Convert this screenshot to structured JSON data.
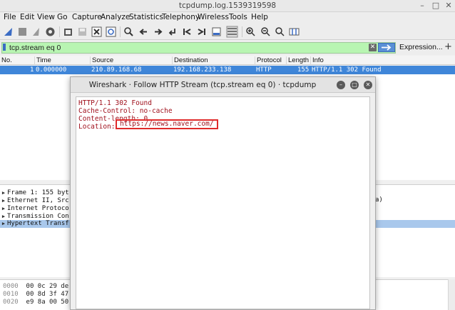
{
  "window": {
    "title": "tcpdump.log.1539319598",
    "controls": [
      "–",
      "□",
      "✕"
    ]
  },
  "menu": [
    "File",
    "Edit",
    "View",
    "Go",
    "Capture",
    "Analyze",
    "Statistics",
    "Telephony",
    "Wireless",
    "Tools",
    "Help"
  ],
  "toolbar": {
    "icons": [
      "shark-fin-start-icon",
      "stop-capture-icon",
      "restart-capture-icon",
      "capture-options-icon",
      "open-file-icon",
      "save-file-icon",
      "close-file-icon",
      "reload-file-icon",
      "find-packet-icon",
      "go-back-icon",
      "go-forward-icon",
      "go-to-packet-icon",
      "first-packet-icon",
      "last-packet-icon",
      "auto-scroll-icon",
      "colorize-icon",
      "zoom-in-icon",
      "zoom-out-icon",
      "normal-size-icon",
      "resize-columns-icon"
    ]
  },
  "filter": {
    "value": "tcp.stream eq 0",
    "clear_label": "✕",
    "expression_label": "Expression...",
    "plus_label": "+"
  },
  "packet_list": {
    "columns": [
      "No.",
      "Time",
      "Source",
      "Destination",
      "Protocol",
      "Length",
      "Info"
    ],
    "rows": [
      {
        "no": "1",
        "time": "0.000000",
        "source": "210.89.168.68",
        "destination": "192.168.233.138",
        "protocol": "HTTP",
        "length": "155",
        "info": "HTTP/1.1 302 Found"
      }
    ]
  },
  "details": {
    "rows": [
      "Frame 1: 155 byt",
      "Ethernet II, Src",
      "Internet Protoco",
      "Transmission Con",
      "Hypertext Transf"
    ],
    "right_fragment": "a)"
  },
  "hex": {
    "rows": [
      {
        "offset": "0000",
        "bytes": "00 0c 29 de"
      },
      {
        "offset": "0010",
        "bytes": "00 8d 3f 47"
      },
      {
        "offset": "0020",
        "bytes": "e9 8a 00 50"
      }
    ]
  },
  "dialog": {
    "title": "Wireshark · Follow HTTP Stream (tcp.stream eq 0) · tcpdump",
    "lines": [
      "HTTP/1.1 302 Found",
      "Cache-Control: no-cache",
      "Content-length: 0",
      "Location: "
    ],
    "location_value": "https://news.naver.com/",
    "highlight_color": "#e02a2a",
    "text_color": "#a0101c"
  },
  "colors": {
    "filter_bg": "#b8f5b2",
    "selected_row": "#3f86d9",
    "selected_tree_row": "#a9c8ec"
  }
}
